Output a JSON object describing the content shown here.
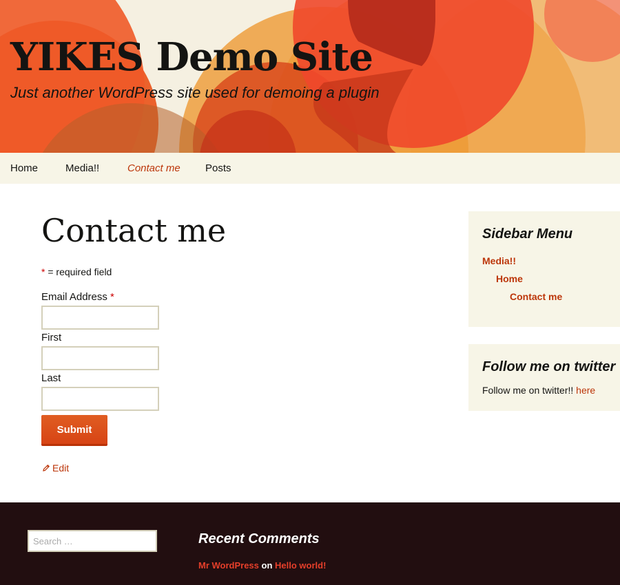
{
  "header": {
    "site_title": "YIKES Demo Site",
    "site_description": "Just another WordPress site used for demoing a plugin"
  },
  "nav": {
    "items": [
      {
        "label": "Home"
      },
      {
        "label": "Media!!"
      },
      {
        "label": "Contact me",
        "current": true
      },
      {
        "label": "Posts"
      }
    ]
  },
  "main": {
    "title": "Contact me",
    "required_star": "*",
    "required_note": " = required field",
    "fields": [
      {
        "label": "Email Address",
        "required": true,
        "value": ""
      },
      {
        "label": "First",
        "required": false,
        "value": ""
      },
      {
        "label": "Last",
        "required": false,
        "value": ""
      }
    ],
    "submit_label": "Submit",
    "edit_label": "Edit"
  },
  "sidebar": {
    "menu_widget": {
      "title": "Sidebar Menu",
      "items": [
        {
          "label": "Media!!",
          "level": 0
        },
        {
          "label": "Home",
          "level": 1
        },
        {
          "label": "Contact me",
          "level": 2
        }
      ]
    },
    "twitter_widget": {
      "title": "Follow me on twitter",
      "text": "Follow me on twitter!! ",
      "link_label": "here"
    }
  },
  "footer": {
    "search": {
      "placeholder": "Search …",
      "value": ""
    },
    "recent_comments": {
      "title": "Recent Comments",
      "author": "Mr WordPress",
      "connector": " on ",
      "post": "Hello world!"
    }
  },
  "colors": {
    "accent": "#bc360a",
    "button": "#e05d22",
    "nav_background": "#f7f5e7",
    "footer_background": "#220e10",
    "comment_link": "#e63f2a",
    "required_star": "#cc0000"
  },
  "icons": {
    "edit": "pencil-icon",
    "header": "decorative-circles-artwork"
  }
}
